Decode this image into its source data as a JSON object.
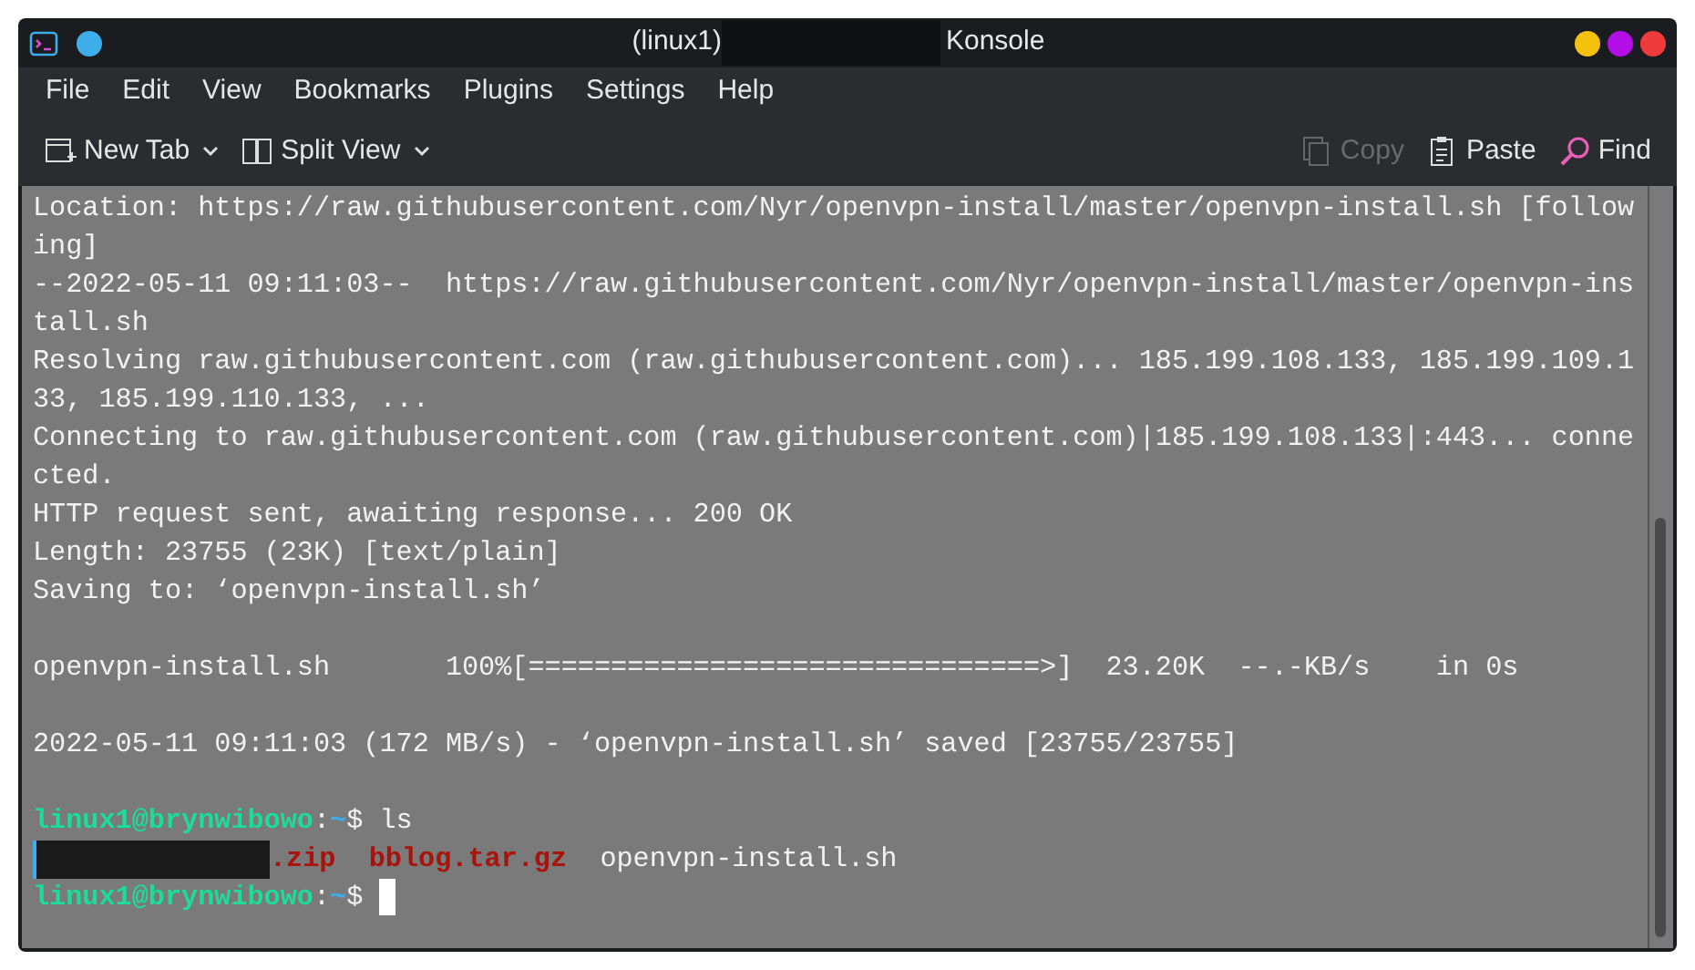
{
  "window": {
    "title_left": "(linux1)",
    "title_right": "Konsole"
  },
  "menu": [
    "File",
    "Edit",
    "View",
    "Bookmarks",
    "Plugins",
    "Settings",
    "Help"
  ],
  "toolbar": [
    {
      "label": "New Tab",
      "dropdown": true,
      "disabled": false
    },
    {
      "label": "Split View",
      "dropdown": true,
      "disabled": false
    },
    {
      "label": "Copy",
      "dropdown": false,
      "disabled": true
    },
    {
      "label": "Paste",
      "dropdown": false,
      "disabled": false
    },
    {
      "label": "Find",
      "dropdown": false,
      "disabled": false
    }
  ],
  "terminal": {
    "lines": [
      {
        "kind": "output",
        "text": "Location: https://raw.githubusercontent.com/Nyr/openvpn-install/master/openvpn-install.sh [follow"
      },
      {
        "kind": "output",
        "text": "ing]"
      },
      {
        "kind": "output",
        "text": "--2022-05-11 09:11:03--  https://raw.githubusercontent.com/Nyr/openvpn-install/master/openvpn-ins"
      },
      {
        "kind": "output",
        "text": "tall.sh"
      },
      {
        "kind": "output",
        "text": "Resolving raw.githubusercontent.com (raw.githubusercontent.com)... 185.199.108.133, 185.199.109.1"
      },
      {
        "kind": "output",
        "text": "33, 185.199.110.133, ..."
      },
      {
        "kind": "output",
        "text": "Connecting to raw.githubusercontent.com (raw.githubusercontent.com)|185.199.108.133|:443... conne"
      },
      {
        "kind": "output",
        "text": "cted."
      },
      {
        "kind": "output",
        "text": "HTTP request sent, awaiting response... 200 OK"
      },
      {
        "kind": "output",
        "text": "Length: 23755 (23K) [text/plain]"
      },
      {
        "kind": "output",
        "text": "Saving to: ‘openvpn-install.sh’"
      },
      {
        "kind": "blank"
      },
      {
        "kind": "output",
        "text": "openvpn-install.sh       100%[===============================>]  23.20K  --.-KB/s    in 0s"
      },
      {
        "kind": "blank"
      },
      {
        "kind": "output",
        "text": "2022-05-11 09:11:03 (172 MB/s) - ‘openvpn-install.sh’ saved [23755/23755]"
      },
      {
        "kind": "blank"
      },
      {
        "kind": "prompt",
        "user": "linux1@brynwibowo",
        "sep": ":",
        "path": "~",
        "command": "$ ls",
        "cursor": false
      },
      {
        "kind": "files",
        "files": [
          {
            "kind": "redacted"
          },
          {
            "kind": "archive",
            "text": ".zip"
          },
          {
            "kind": "archive",
            "text": "bblog.tar.gz"
          },
          {
            "kind": "plain",
            "text": "openvpn-install.sh"
          }
        ]
      },
      {
        "kind": "prompt",
        "user": "linux1@brynwibowo",
        "sep": ":",
        "path": "~",
        "command": "$",
        "cursor": true
      }
    ]
  }
}
